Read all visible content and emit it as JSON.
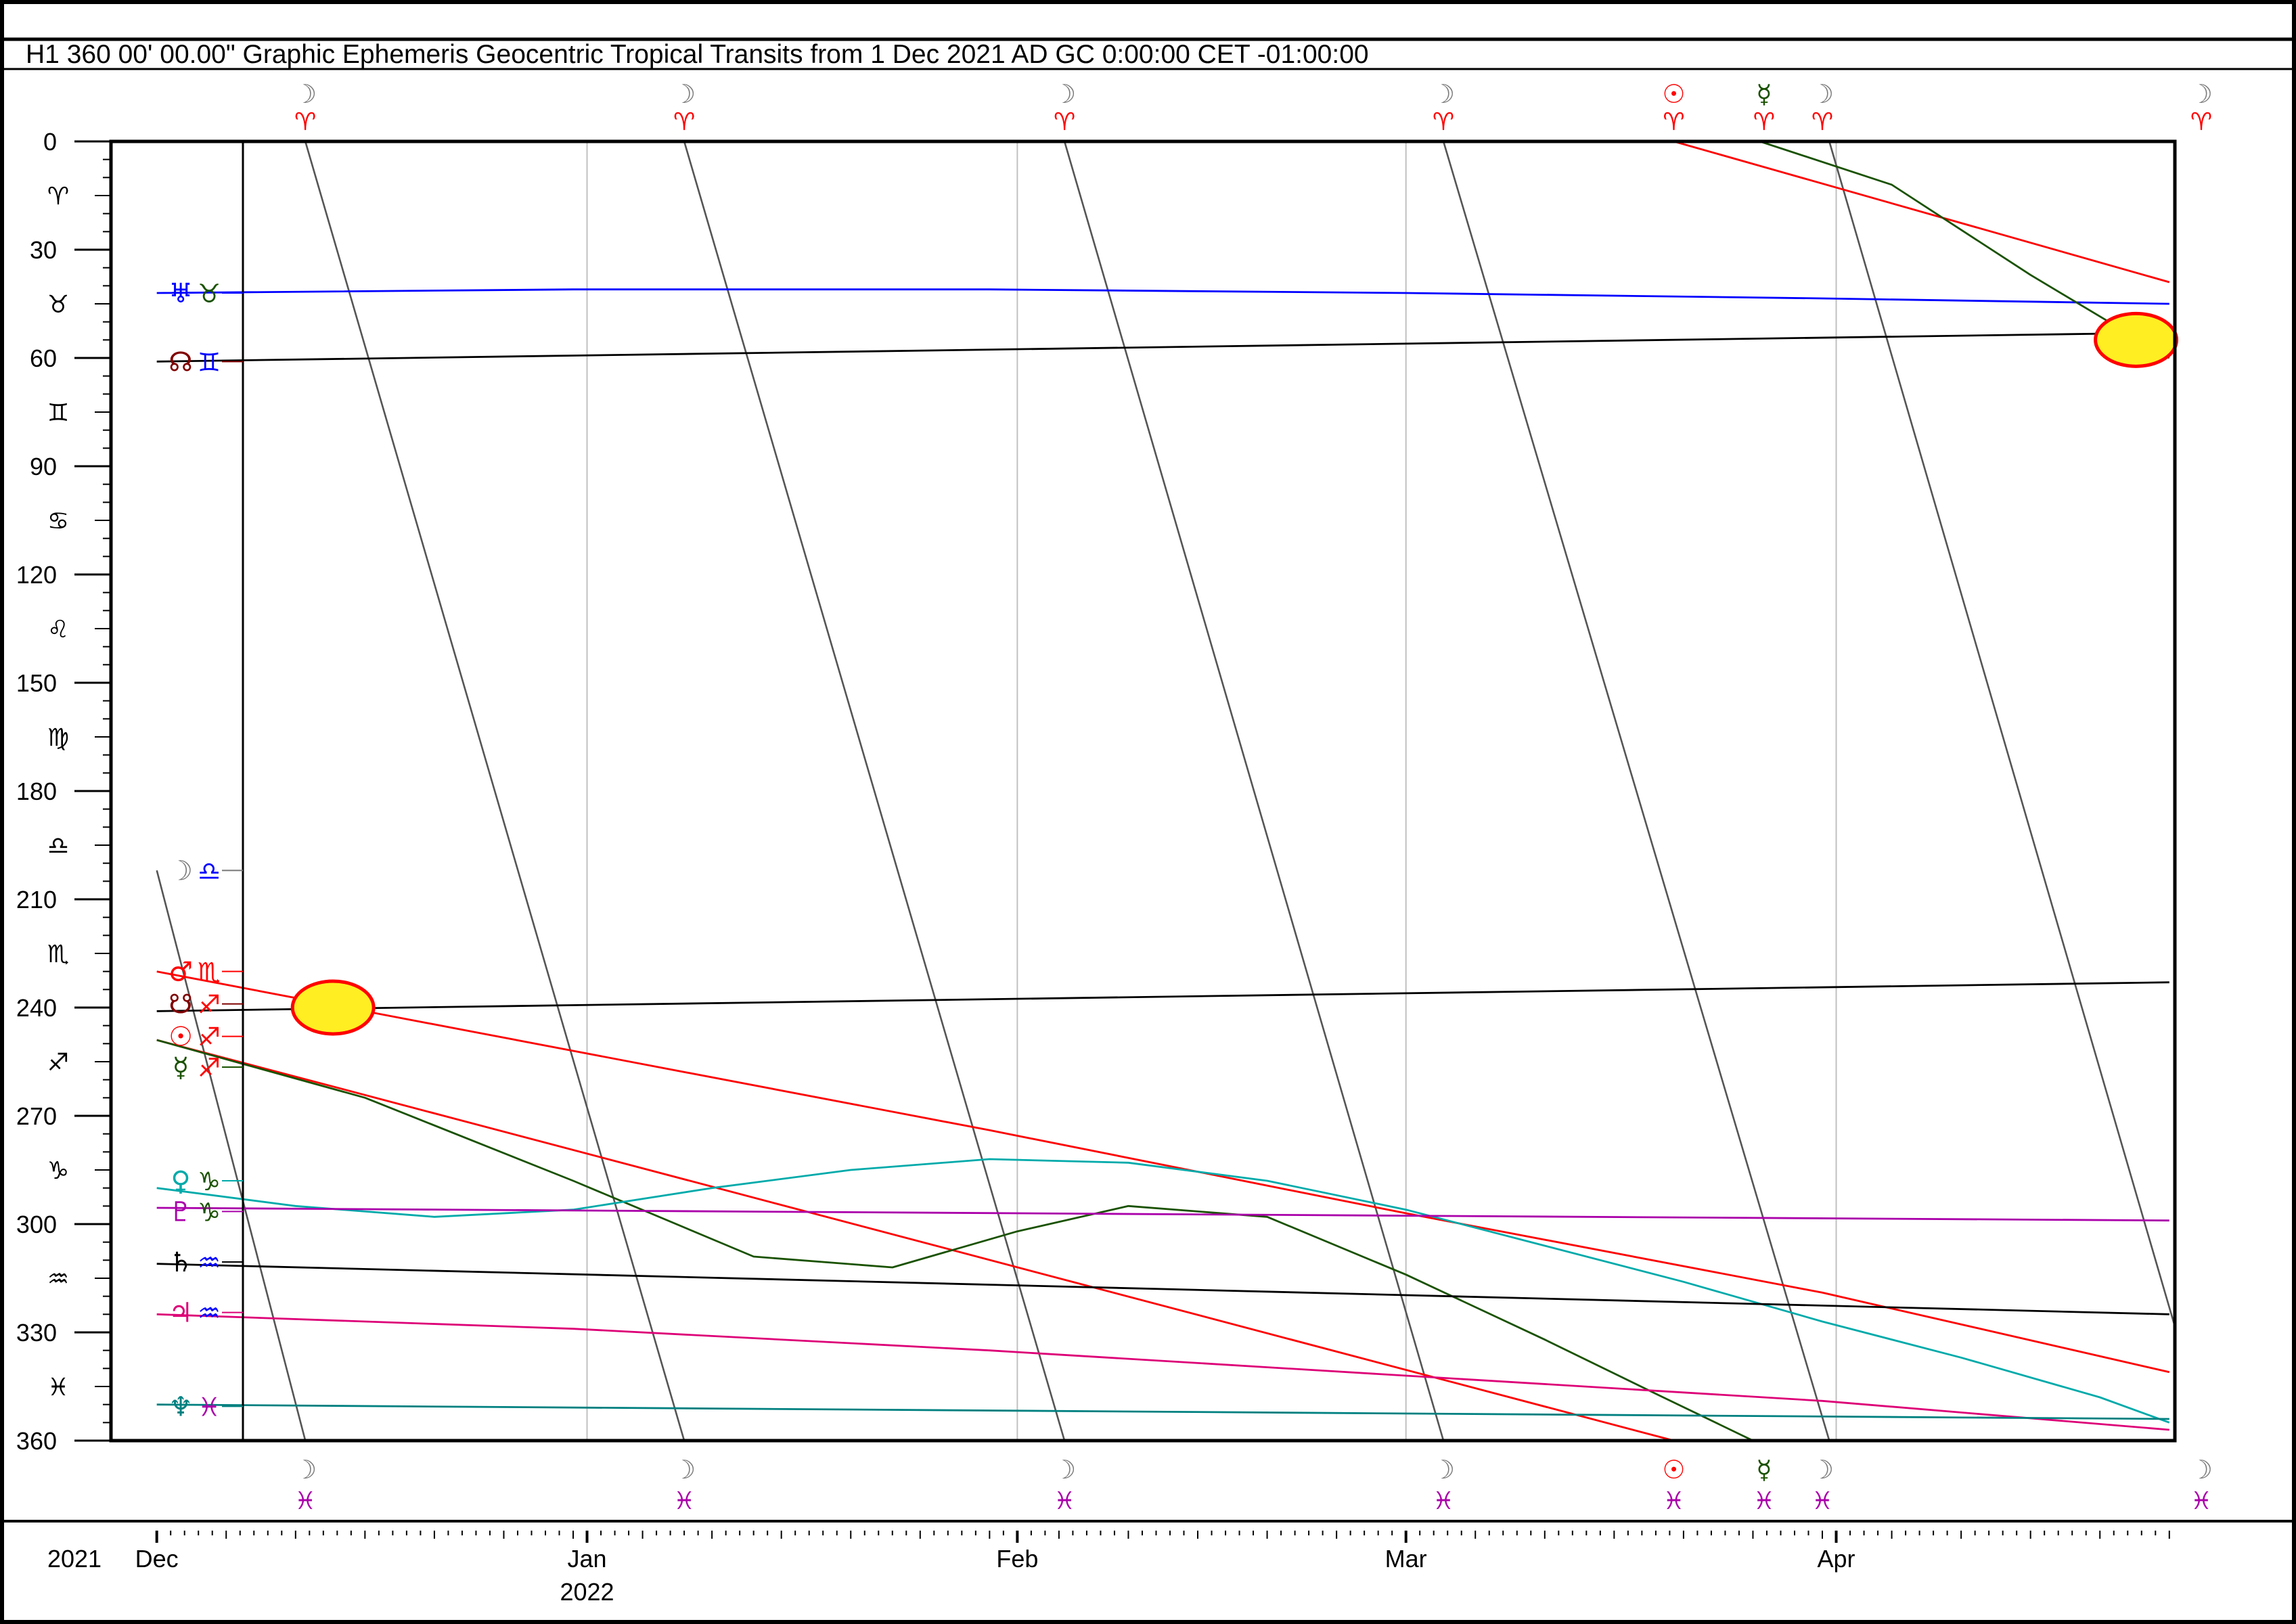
{
  "header": {
    "title": "H1   360 00' 00.00\" Graphic Ephemeris Geocentric Tropical Transits from 1 Dec 2021 AD GC 0:00:00 CET -01:00:00"
  },
  "colors": {
    "frame": "#000000",
    "moon": "#555555",
    "sun": "#ff0000",
    "mars": "#ff0000",
    "mercury": "#1a5200",
    "venus": "#00aaaa",
    "pluto": "#aa00aa",
    "saturn": "#000000",
    "jupiter": "#dd0077",
    "neptune": "#008080",
    "uranus": "#0000ff",
    "nodes": "#800000",
    "eclipse_fill": "#ffee22",
    "eclipse_edge": "#ff0000",
    "month_grid": "#c0c0c0"
  },
  "chart_data": {
    "type": "line",
    "title": "H1   360 00' 00.00\" Graphic Ephemeris Geocentric Tropical Transits from 1 Dec 2021 AD GC 0:00:00 CET -01:00:00",
    "xlabel": "",
    "ylabel": "",
    "x_unit": "days from 1 Dec 2021",
    "xlim": [
      -3.3,
      145.4
    ],
    "ylim": [
      0,
      360
    ],
    "y_ticks": [
      0,
      30,
      60,
      90,
      120,
      150,
      180,
      210,
      240,
      270,
      300,
      330,
      360
    ],
    "zodiac_ticks": [
      "♈",
      "♉",
      "♊",
      "♋",
      "♌",
      "♍",
      "♎",
      "♏",
      "♐",
      "♑",
      "♒",
      "♓"
    ],
    "month_labels": [
      {
        "label": "Dec",
        "day": 0
      },
      {
        "label": "Jan",
        "day": 31
      },
      {
        "label": "Feb",
        "day": 62
      },
      {
        "label": "Mar",
        "day": 90
      },
      {
        "label": "Apr",
        "day": 121
      }
    ],
    "year_left": "2021",
    "year_mid": "2022",
    "grid": true,
    "eclipses": [
      {
        "day": 12.7,
        "deg": 240
      },
      {
        "day": 142.6,
        "deg": 55
      }
    ],
    "series": [
      {
        "key": "moon",
        "glyph": "☽",
        "sign": "♎",
        "sign_color": "#0000ff",
        "glyph_color": "#777777",
        "segments": [
          [
            [
              0,
              202
            ],
            [
              10.7,
              360
            ]
          ],
          [
            [
              10.7,
              0
            ],
            [
              38.0,
              360
            ]
          ],
          [
            [
              38.0,
              0
            ],
            [
              65.4,
              360
            ]
          ],
          [
            [
              65.4,
              0
            ],
            [
              92.7,
              360
            ]
          ],
          [
            [
              92.7,
              0
            ],
            [
              120.5,
              360
            ]
          ],
          [
            [
              120.5,
              0
            ],
            [
              147.8,
              360
            ]
          ]
        ]
      },
      {
        "key": "sun",
        "glyph": "☉",
        "sign": "♐",
        "sign_color": "#ff0000",
        "glyph_color": "#ff0000",
        "segments": [
          [
            [
              0,
              249
            ],
            [
              109.3,
              360
            ]
          ],
          [
            [
              109.3,
              0
            ],
            [
              145,
              39
            ]
          ]
        ]
      },
      {
        "key": "mars",
        "glyph": "♂",
        "sign": "♏",
        "sign_color": "#ff0000",
        "glyph_color": "#ff0000",
        "points": [
          [
            0,
            230
          ],
          [
            30,
            252
          ],
          [
            60,
            274
          ],
          [
            90,
            297
          ],
          [
            120,
            319
          ],
          [
            145,
            341
          ]
        ]
      },
      {
        "key": "south-node",
        "glyph": "☋",
        "sign": "♐",
        "sign_color": "#ff0000",
        "glyph_color": "#800000",
        "points": [
          [
            0,
            241
          ],
          [
            145,
            233
          ]
        ]
      },
      {
        "key": "node",
        "glyph": "☊",
        "sign": "♊",
        "sign_color": "#0000ff",
        "glyph_color": "#800000",
        "points": [
          [
            0,
            61
          ],
          [
            145,
            53
          ]
        ]
      },
      {
        "key": "uranus",
        "glyph": "♅",
        "sign": "♉",
        "sign_color": "#1a5200",
        "glyph_color": "#0000ff",
        "points": [
          [
            0,
            42
          ],
          [
            30,
            41
          ],
          [
            60,
            41
          ],
          [
            90,
            42
          ],
          [
            120,
            43.5
          ],
          [
            145,
            45
          ]
        ]
      },
      {
        "key": "mercury",
        "glyph": "☿",
        "sign": "♐",
        "sign_color": "#ff0000",
        "glyph_color": "#1a5200",
        "segments": [
          [
            [
              0,
              249
            ],
            [
              15,
              265
            ],
            [
              30,
              288
            ],
            [
              43,
              309
            ],
            [
              53,
              312
            ],
            [
              62,
              302
            ],
            [
              70,
              295
            ],
            [
              80,
              298
            ],
            [
              90,
              314
            ],
            [
              100,
              332
            ],
            [
              108,
              347
            ],
            [
              115,
              360
            ]
          ],
          [
            [
              115.5,
              0
            ],
            [
              125,
              12
            ],
            [
              135,
              37
            ],
            [
              145,
              60
            ]
          ]
        ]
      },
      {
        "key": "venus",
        "glyph": "♀",
        "sign": "♑",
        "sign_color": "#1a5200",
        "glyph_color": "#00aaaa",
        "points": [
          [
            0,
            290
          ],
          [
            10,
            295
          ],
          [
            20,
            298
          ],
          [
            30,
            296
          ],
          [
            40,
            290
          ],
          [
            50,
            285
          ],
          [
            60,
            282
          ],
          [
            70,
            283
          ],
          [
            80,
            288
          ],
          [
            90,
            296
          ],
          [
            100,
            306
          ],
          [
            110,
            316
          ],
          [
            120,
            327
          ],
          [
            130,
            337
          ],
          [
            140,
            348
          ],
          [
            145,
            355
          ]
        ]
      },
      {
        "key": "pluto",
        "glyph": "♇",
        "sign": "♑",
        "sign_color": "#1a5200",
        "glyph_color": "#aa00aa",
        "points": [
          [
            0,
            295.5
          ],
          [
            145,
            299
          ]
        ]
      },
      {
        "key": "saturn",
        "glyph": "♄",
        "sign": "♒",
        "sign_color": "#0000ff",
        "glyph_color": "#000000",
        "points": [
          [
            0,
            311
          ],
          [
            145,
            325
          ]
        ]
      },
      {
        "key": "jupiter",
        "glyph": "♃",
        "sign": "♒",
        "sign_color": "#0000ff",
        "glyph_color": "#dd0077",
        "points": [
          [
            0,
            325
          ],
          [
            30,
            329
          ],
          [
            60,
            335
          ],
          [
            90,
            342
          ],
          [
            120,
            349
          ],
          [
            145,
            357
          ]
        ]
      },
      {
        "key": "neptune",
        "glyph": "♆",
        "sign": "♓",
        "sign_color": "#aa00aa",
        "glyph_color": "#008080",
        "points": [
          [
            0,
            350
          ],
          [
            145,
            354
          ]
        ]
      }
    ],
    "planet_label_rows": [
      {
        "glyph": "♅",
        "glyph_color": "#0000ff",
        "sign": "♉",
        "sign_color": "#1a5200",
        "deg": 42
      },
      {
        "glyph": "☊",
        "glyph_color": "#800000",
        "sign": "♊",
        "sign_color": "#0000ff",
        "deg": 61
      },
      {
        "glyph": "☽",
        "glyph_color": "#777777",
        "sign": "♎",
        "sign_color": "#0000ff",
        "deg": 202
      },
      {
        "glyph": "♂",
        "glyph_color": "#ff0000",
        "sign": "♏",
        "sign_color": "#ff0000",
        "deg": 230
      },
      {
        "glyph": "☋",
        "glyph_color": "#800000",
        "sign": "♐",
        "sign_color": "#ff0000",
        "deg": 239
      },
      {
        "glyph": "☉",
        "glyph_color": "#ff0000",
        "sign": "♐",
        "sign_color": "#ff0000",
        "deg": 248
      },
      {
        "glyph": "☿",
        "glyph_color": "#1a5200",
        "sign": "♐",
        "sign_color": "#ff0000",
        "deg": 256.5
      },
      {
        "glyph": "♀",
        "glyph_color": "#00aaaa",
        "sign": "♑",
        "sign_color": "#1a5200",
        "deg": 288
      },
      {
        "glyph": "♇",
        "glyph_color": "#aa00aa",
        "sign": "♑",
        "sign_color": "#1a5200",
        "deg": 296.5
      },
      {
        "glyph": "♄",
        "glyph_color": "#000000",
        "sign": "♒",
        "sign_color": "#0000ff",
        "deg": 310.5
      },
      {
        "glyph": "♃",
        "glyph_color": "#dd0077",
        "sign": "♒",
        "sign_color": "#0000ff",
        "deg": 324.5
      },
      {
        "glyph": "♆",
        "glyph_color": "#008080",
        "sign": "♓",
        "sign_color": "#aa00aa",
        "deg": 350.5
      }
    ],
    "ingress_markers": [
      {
        "glyph": "☽",
        "glyph_color": "#777777",
        "day": 10.7
      },
      {
        "glyph": "☽",
        "glyph_color": "#777777",
        "day": 38.0
      },
      {
        "glyph": "☽",
        "glyph_color": "#777777",
        "day": 65.4
      },
      {
        "glyph": "☽",
        "glyph_color": "#777777",
        "day": 92.7
      },
      {
        "glyph": "☉",
        "glyph_color": "#ff0000",
        "day": 109.3
      },
      {
        "glyph": "☿",
        "glyph_color": "#1a5200",
        "day": 115.8
      },
      {
        "glyph": "☽",
        "glyph_color": "#777777",
        "day": 120.0
      },
      {
        "glyph": "☽",
        "glyph_color": "#777777",
        "day": 147.3
      }
    ],
    "ingress_top_sign": "♈",
    "ingress_top_sign_color": "#ff0000",
    "ingress_bottom_sign": "♓",
    "ingress_bottom_sign_color": "#aa00aa"
  }
}
